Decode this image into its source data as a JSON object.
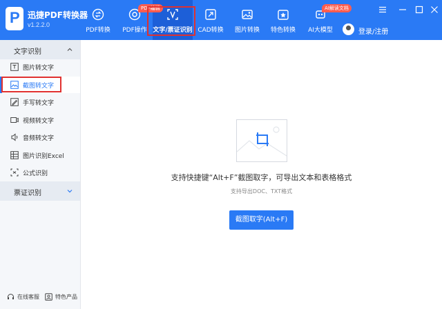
{
  "app": {
    "title": "迅捷PDF转换器",
    "version": "v1.2.2.0"
  },
  "nav": [
    {
      "label": "PDF转换",
      "icon": "pdf-convert-icon"
    },
    {
      "label": "PDF操作",
      "icon": "pdf-operate-icon"
    },
    {
      "label": "文字/票证识别",
      "icon": "text-recognition-icon",
      "active": true,
      "badge": "PDF编辑"
    },
    {
      "label": "CAD转换",
      "icon": "cad-convert-icon"
    },
    {
      "label": "图片转换",
      "icon": "image-convert-icon"
    },
    {
      "label": "特色转换",
      "icon": "feature-convert-icon"
    },
    {
      "label": "AI大模型",
      "icon": "ai-model-icon",
      "badge": "AI解读文档"
    }
  ],
  "user": {
    "login_label": "登录/注册"
  },
  "window_controls": [
    "menu-icon",
    "minimize-icon",
    "maximize-icon",
    "close-icon"
  ],
  "sidebar": {
    "group_text": {
      "label": "文字识别",
      "expanded": true
    },
    "items": [
      {
        "label": "图片转文字",
        "icon": "image-text-icon"
      },
      {
        "label": "截图转文字",
        "icon": "screenshot-icon",
        "active": true
      },
      {
        "label": "手写转文字",
        "icon": "handwriting-icon"
      },
      {
        "label": "视频转文字",
        "icon": "video-icon"
      },
      {
        "label": "音频转文字",
        "icon": "audio-icon"
      },
      {
        "label": "图片识别Excel",
        "icon": "excel-icon"
      },
      {
        "label": "公式识别",
        "icon": "formula-icon"
      }
    ],
    "group_ticket": {
      "label": "票证识别",
      "expanded": false
    }
  },
  "bottom_links": {
    "service": "在线客服",
    "products": "特色产品"
  },
  "main": {
    "title": "支持快捷键“Alt+F”截图取字，可导出文本和表格格式",
    "subtitle": "支持导出DOC、TXT格式",
    "button": "截图取字(Alt+F)"
  },
  "colors": {
    "brand": "#2a7af5",
    "active_nav": "#1d5fd8",
    "highlight": "#e0302f",
    "badge": "#ff5d4f"
  }
}
